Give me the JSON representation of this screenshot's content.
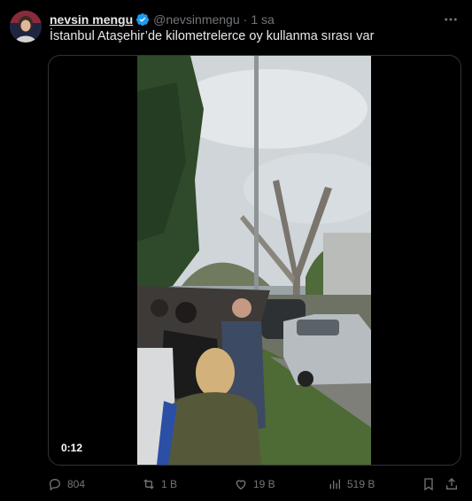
{
  "author": {
    "display_name": "nevsin mengu",
    "handle": "@nevsinmengu",
    "separator": "·",
    "time": "1 sa"
  },
  "tweet": {
    "text": "İstanbul Ataşehir’de kilometrelerce oy kullanma sırası var"
  },
  "media": {
    "duration": "0:12"
  },
  "actions": {
    "replies": "804",
    "reposts": "1 B",
    "likes": "19 B",
    "views": "519 B"
  },
  "colors": {
    "background": "#000000",
    "text": "#e7e9ea",
    "muted": "#71767b",
    "verified": "#1d9bf0",
    "border": "#2f3336"
  }
}
